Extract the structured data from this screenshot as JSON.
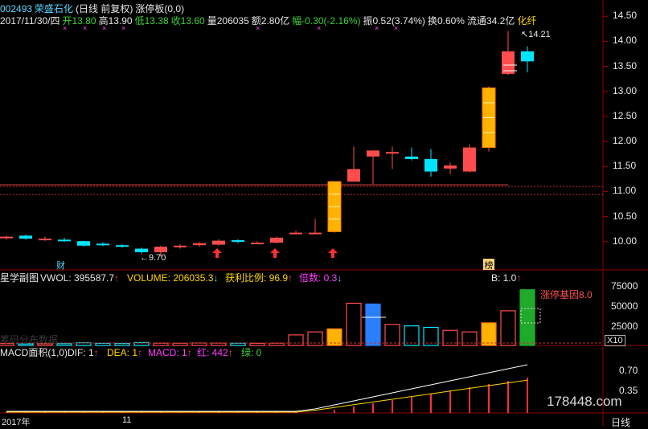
{
  "header": {
    "code": "002493",
    "name": "荣盛石化",
    "period": "(日线 前复权)",
    "indicator": "涨停板(0,0)",
    "date": "2017/11/30/四",
    "open_label": "开",
    "open": "13.80",
    "high_label": "高",
    "high": "13.90",
    "low_label": "低",
    "low": "13.38",
    "low2_label": "收",
    "close": "13.60",
    "vol_label": "量",
    "volume": "206035",
    "amount_label": "额",
    "amount": "2.80亿",
    "change_label": "幅",
    "change": "-0.30(-2.16%)",
    "amp_label": "振",
    "amplitude": "0.52(3.74%)",
    "turnover_label": "换",
    "turnover": "0.60%",
    "float_label": "流通",
    "float_cap": "34.2亿",
    "sector": "化纤"
  },
  "price_axis": {
    "ticks": [
      "14.50",
      "14.00",
      "13.50",
      "13.00",
      "12.50",
      "12.00",
      "11.50",
      "11.00",
      "10.50",
      "10.00"
    ]
  },
  "annotations": {
    "high_mark": "14.21",
    "low_mark": "9.70",
    "cai_badge": "财",
    "bang_badge": "榜"
  },
  "vol_panel": {
    "title": "星学副图",
    "vol": "VWOL: 395587.7",
    "vol2": "VOLUME: 206035.3",
    "profit": "获利比例: 96.9",
    "mult": "倍数: 0.3",
    "b_label": "B: 1.0",
    "limit_label": "涨停基因",
    "limit_value": "8.0",
    "faint": "筹码分布数据",
    "x10": "X10",
    "ticks": [
      "75000",
      "50000",
      "25000"
    ]
  },
  "macd_panel": {
    "title": "MACD面积(1,0)",
    "dif": "DIF: 1",
    "dea": "DEA: 1",
    "macd": "MACD: 1",
    "red": "红: 442",
    "green": "绿: 0",
    "ticks": [
      "0.70",
      "0.35"
    ]
  },
  "time_axis": {
    "year": "2017年",
    "month": "11",
    "period": "日线"
  },
  "watermark": "178448.com",
  "colors": {
    "up": "#ff4d4d",
    "down": "#00e5ff",
    "grid": "#7a0000",
    "border": "#8b0000"
  },
  "chart_data": {
    "type": "candlestick",
    "ylim": [
      9.5,
      14.6
    ],
    "candles": [
      {
        "o": 10.08,
        "h": 10.12,
        "l": 10.04,
        "c": 10.1
      },
      {
        "o": 10.12,
        "h": 10.14,
        "l": 10.04,
        "c": 10.06
      },
      {
        "o": 10.05,
        "h": 10.1,
        "l": 10.02,
        "c": 10.06
      },
      {
        "o": 10.04,
        "h": 10.08,
        "l": 10.0,
        "c": 10.03
      },
      {
        "o": 10.01,
        "h": 10.02,
        "l": 9.9,
        "c": 9.92
      },
      {
        "o": 9.96,
        "h": 9.99,
        "l": 9.91,
        "c": 9.94
      },
      {
        "o": 9.93,
        "h": 9.95,
        "l": 9.88,
        "c": 9.9
      },
      {
        "o": 9.86,
        "h": 9.88,
        "l": 9.76,
        "c": 9.79
      },
      {
        "o": 9.79,
        "h": 9.92,
        "l": 9.7,
        "c": 9.9
      },
      {
        "o": 9.89,
        "h": 9.95,
        "l": 9.86,
        "c": 9.92
      },
      {
        "o": 9.93,
        "h": 9.99,
        "l": 9.9,
        "c": 9.97
      },
      {
        "o": 9.94,
        "h": 10.05,
        "l": 9.92,
        "c": 10.02
      },
      {
        "o": 10.03,
        "h": 10.05,
        "l": 9.97,
        "c": 10.0
      },
      {
        "o": 9.97,
        "h": 10.01,
        "l": 9.95,
        "c": 9.98
      },
      {
        "o": 9.98,
        "h": 10.1,
        "l": 9.96,
        "c": 10.08
      },
      {
        "o": 10.18,
        "h": 10.22,
        "l": 10.16,
        "c": 10.18
      },
      {
        "o": 10.18,
        "h": 10.46,
        "l": 10.16,
        "c": 10.18
      },
      {
        "o": 10.2,
        "h": 11.2,
        "l": 10.18,
        "c": 11.2
      },
      {
        "o": 11.2,
        "h": 11.9,
        "l": 11.2,
        "c": 11.45
      },
      {
        "o": 11.7,
        "h": 11.78,
        "l": 11.15,
        "c": 11.82
      },
      {
        "o": 11.79,
        "h": 11.9,
        "l": 11.45,
        "c": 11.79
      },
      {
        "o": 11.7,
        "h": 11.88,
        "l": 11.62,
        "c": 11.65
      },
      {
        "o": 11.65,
        "h": 11.85,
        "l": 11.3,
        "c": 11.4
      },
      {
        "o": 11.46,
        "h": 11.58,
        "l": 11.35,
        "c": 11.52
      },
      {
        "o": 11.4,
        "h": 11.94,
        "l": 11.38,
        "c": 11.88
      },
      {
        "o": 11.88,
        "h": 13.1,
        "l": 11.8,
        "c": 13.07
      },
      {
        "o": 13.35,
        "h": 14.21,
        "l": 13.33,
        "c": 13.8
      },
      {
        "o": 13.8,
        "h": 13.9,
        "l": 13.38,
        "c": 13.6
      }
    ],
    "volumes": [
      2500,
      2000,
      2200,
      2300,
      3500,
      2800,
      2600,
      3800,
      3000,
      2900,
      3200,
      3100,
      2900,
      2800,
      3000,
      14000,
      18000,
      22000,
      56000,
      55000,
      28000,
      26000,
      24000,
      20000,
      18000,
      30000,
      46000,
      74000,
      20000
    ]
  }
}
